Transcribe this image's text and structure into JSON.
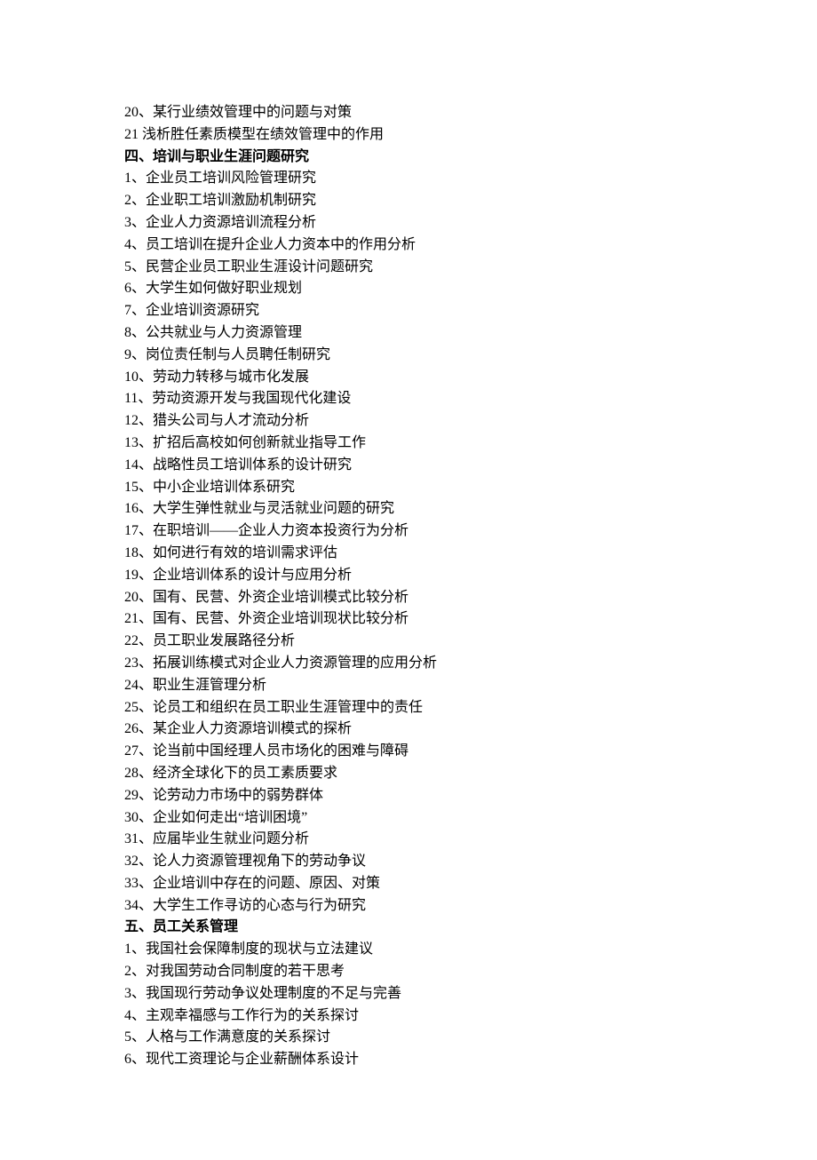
{
  "lines": [
    {
      "text": "20、某行业绩效管理中的问题与对策",
      "bold": false
    },
    {
      "text": "21 浅析胜任素质模型在绩效管理中的作用",
      "bold": false
    },
    {
      "text": "四、培训与职业生涯问题研究",
      "bold": true
    },
    {
      "text": "1、企业员工培训风险管理研究",
      "bold": false
    },
    {
      "text": "2、企业职工培训激励机制研究",
      "bold": false
    },
    {
      "text": "3、企业人力资源培训流程分析",
      "bold": false
    },
    {
      "text": "4、员工培训在提升企业人力资本中的作用分析",
      "bold": false
    },
    {
      "text": "5、民营企业员工职业生涯设计问题研究",
      "bold": false
    },
    {
      "text": "6、大学生如何做好职业规划",
      "bold": false
    },
    {
      "text": "7、企业培训资源研究",
      "bold": false
    },
    {
      "text": "8、公共就业与人力资源管理",
      "bold": false
    },
    {
      "text": "9、岗位责任制与人员聘任制研究",
      "bold": false
    },
    {
      "text": "10、劳动力转移与城市化发展",
      "bold": false
    },
    {
      "text": "11、劳动资源开发与我国现代化建设",
      "bold": false
    },
    {
      "text": "12、猎头公司与人才流动分析",
      "bold": false
    },
    {
      "text": "13、扩招后高校如何创新就业指导工作",
      "bold": false
    },
    {
      "text": "14、战略性员工培训体系的设计研究",
      "bold": false
    },
    {
      "text": "15、中小企业培训体系研究",
      "bold": false
    },
    {
      "text": "16、大学生弹性就业与灵活就业问题的研究",
      "bold": false
    },
    {
      "text": "17、在职培训——企业人力资本投资行为分析",
      "bold": false
    },
    {
      "text": "18、如何进行有效的培训需求评估",
      "bold": false
    },
    {
      "text": "19、企业培训体系的设计与应用分析",
      "bold": false
    },
    {
      "text": "20、国有、民营、外资企业培训模式比较分析",
      "bold": false
    },
    {
      "text": "21、国有、民营、外资企业培训现状比较分析",
      "bold": false
    },
    {
      "text": "22、员工职业发展路径分析",
      "bold": false
    },
    {
      "text": "23、拓展训练模式对企业人力资源管理的应用分析",
      "bold": false
    },
    {
      "text": "24、职业生涯管理分析",
      "bold": false
    },
    {
      "text": "25、论员工和组织在员工职业生涯管理中的责任",
      "bold": false
    },
    {
      "text": "26、某企业人力资源培训模式的探析",
      "bold": false
    },
    {
      "text": "27、论当前中国经理人员市场化的困难与障碍",
      "bold": false
    },
    {
      "text": "28、经济全球化下的员工素质要求",
      "bold": false
    },
    {
      "text": "29、论劳动力市场中的弱势群体",
      "bold": false
    },
    {
      "text": "30、企业如何走出“培训困境”",
      "bold": false
    },
    {
      "text": "31、应届毕业生就业问题分析",
      "bold": false
    },
    {
      "text": "32、论人力资源管理视角下的劳动争议",
      "bold": false
    },
    {
      "text": "33、企业培训中存在的问题、原因、对策",
      "bold": false
    },
    {
      "text": "34、大学生工作寻访的心态与行为研究",
      "bold": false
    },
    {
      "text": "五、员工关系管理",
      "bold": true
    },
    {
      "text": "1、我国社会保障制度的现状与立法建议",
      "bold": false
    },
    {
      "text": "2、对我国劳动合同制度的若干思考",
      "bold": false
    },
    {
      "text": "3、我国现行劳动争议处理制度的不足与完善",
      "bold": false
    },
    {
      "text": "4、主观幸福感与工作行为的关系探讨",
      "bold": false
    },
    {
      "text": "5、人格与工作满意度的关系探讨",
      "bold": false
    },
    {
      "text": "6、现代工资理论与企业薪酬体系设计",
      "bold": false
    }
  ]
}
